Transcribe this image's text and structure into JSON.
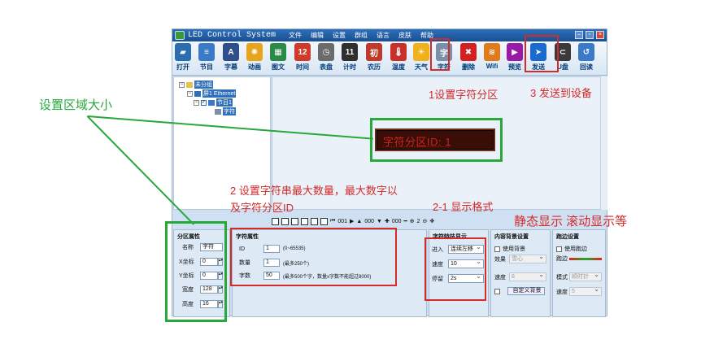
{
  "window": {
    "title": "LED Control System",
    "menu": [
      "文件",
      "编辑",
      "设置",
      "群组",
      "语言",
      "皮肤",
      "帮助"
    ],
    "controls": [
      "–",
      "▫",
      "×"
    ]
  },
  "toolbar": [
    {
      "label": "打开",
      "icon": "folder-icon",
      "color": "#2c6db0"
    },
    {
      "label": "节目",
      "icon": "program-icon",
      "color": "#3a7ac8"
    },
    {
      "label": "字幕",
      "icon": "subtitle-icon",
      "color": "#2f4f8a"
    },
    {
      "label": "动画",
      "icon": "animation-icon",
      "color": "#e6a51a"
    },
    {
      "label": "图文",
      "icon": "picture-text-icon",
      "color": "#2b8a46"
    },
    {
      "label": "时间",
      "icon": "calendar-icon",
      "color": "#d03a2a"
    },
    {
      "label": "表盘",
      "icon": "clock-icon",
      "color": "#6b6b6b"
    },
    {
      "label": "计时",
      "icon": "timer-icon",
      "color": "#2f2f2f"
    },
    {
      "label": "农历",
      "icon": "lunar-icon",
      "color": "#c0392b"
    },
    {
      "label": "温度",
      "icon": "thermometer-icon",
      "color": "#c8302a"
    },
    {
      "label": "天气",
      "icon": "weather-icon",
      "color": "#f0b21a"
    },
    {
      "label": "字符",
      "icon": "character-icon",
      "color": "#7a8fa8"
    },
    {
      "label": "删除",
      "icon": "delete-icon",
      "color": "#d32020"
    },
    {
      "label": "Wifi",
      "icon": "wifi-icon",
      "color": "#e07a1a"
    },
    {
      "label": "预览",
      "icon": "preview-icon",
      "color": "#9a1aa8"
    },
    {
      "label": "发送",
      "icon": "send-icon",
      "color": "#1a6ad0"
    },
    {
      "label": "U盘",
      "icon": "usb-icon",
      "color": "#3a3a3a"
    },
    {
      "label": "回读",
      "icon": "readback-icon",
      "color": "#3a7ac8"
    }
  ],
  "tree": {
    "root": "未分组",
    "screen": "屏1 Ethernet",
    "program": "节目1",
    "area": "字符"
  },
  "led": {
    "text": "字符分区ID: 1"
  },
  "ctrlbar": {
    "num1": "001",
    "num2": "000",
    "num3": "2"
  },
  "partition": {
    "title": "分区属性",
    "name_label": "名称",
    "name_value": "字符",
    "x_label": "X坐标",
    "x_value": "0",
    "y_label": "Y坐标",
    "y_value": "0",
    "w_label": "宽度",
    "w_value": "128",
    "h_label": "高度",
    "h_value": "16"
  },
  "charprops": {
    "title": "字符属性",
    "id_label": "ID",
    "id_value": "1",
    "id_note": "(0~65535)",
    "count_label": "数量",
    "count_value": "1",
    "count_note": "(最多250个)",
    "chars_label": "字数",
    "chars_value": "50",
    "chars_note": "(最多500个字，数量x字数不能超过8000)"
  },
  "display": {
    "title": "字符特技显示",
    "enter_label": "进入",
    "enter_value": "连续左移",
    "speed_label": "速度",
    "speed_value": "10",
    "stay_label": "停留",
    "stay_value": "2s"
  },
  "bg": {
    "title": "内容背景设置",
    "use_label": "使用背景",
    "effect_label": "效果",
    "effect_value": "雪心",
    "speed_label": "速度",
    "speed_value": "8",
    "custom_label": "自定义背景"
  },
  "border": {
    "title": "跑边设置",
    "use_label": "使用跑边",
    "border_label": "跑边",
    "mode_label": "模式",
    "mode_value": "顺时针",
    "speed_label": "速度",
    "speed_value": "5"
  },
  "annotations": {
    "size": "设置区域大小",
    "step1": "1设置字符分区",
    "step3": "3 发送到设备",
    "step2": "2 设置字符串最大数量，最大数字以及字符分区ID",
    "step21": "2-1 显示格式",
    "modes": "静态显示 滚动显示等"
  }
}
